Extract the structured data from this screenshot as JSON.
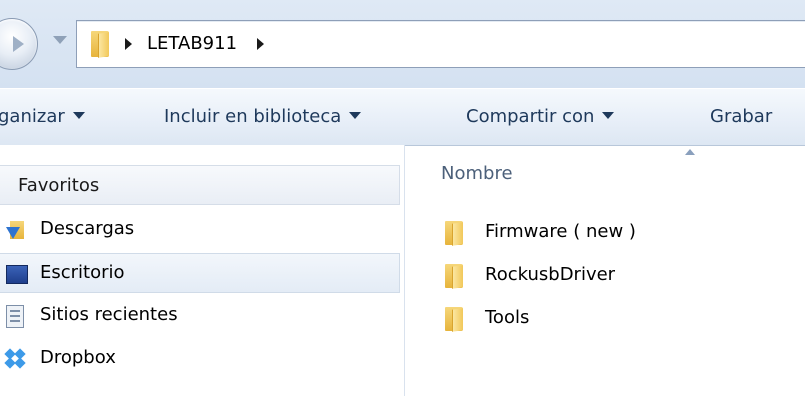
{
  "address_bar": {
    "breadcrumbs": [
      "LETAB911"
    ]
  },
  "toolbar": {
    "items": [
      {
        "label": "ganizar"
      },
      {
        "label": "Incluir en biblioteca"
      },
      {
        "label": "Compartir con"
      },
      {
        "label": "Grabar"
      }
    ]
  },
  "nav_pane": {
    "header": "Favoritos",
    "items": [
      {
        "label": "Descargas",
        "icon": "downloads-icon"
      },
      {
        "label": "Escritorio",
        "icon": "desktop-icon"
      },
      {
        "label": "Sitios recientes",
        "icon": "recent-places-icon"
      },
      {
        "label": "Dropbox",
        "icon": "dropbox-icon"
      }
    ]
  },
  "content": {
    "column_header": "Nombre",
    "files": [
      {
        "name": "Firmware ( new )",
        "icon": "folder-icon"
      },
      {
        "name": "RockusbDriver",
        "icon": "folder-icon"
      },
      {
        "name": "Tools",
        "icon": "folder-icon"
      }
    ]
  },
  "colors": {
    "accent": "#1e395b",
    "folder": "#f2c85a",
    "selection": "#e4ecf6"
  }
}
